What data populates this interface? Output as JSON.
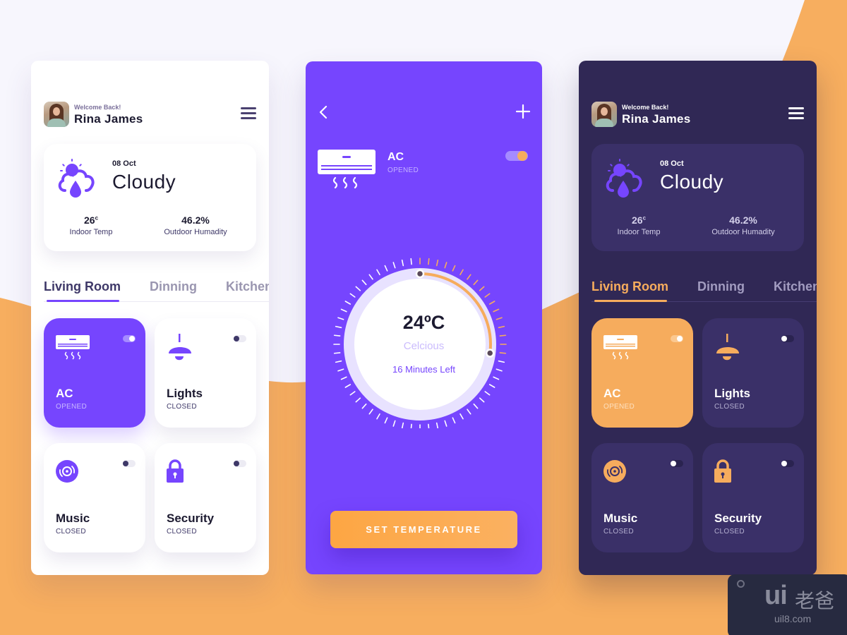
{
  "colors": {
    "primary": "#7645fe",
    "accent": "#f6ac5d",
    "dark_bg": "#302855",
    "dark_card": "#3a3068",
    "light_bg": "#f7f6fd"
  },
  "screens": {
    "light": {
      "header": {
        "welcome": "Welcome Back!",
        "name": "Rina James",
        "menu_icon": "hamburger-menu-icon"
      },
      "weather": {
        "icon": "cloud-rain-sun-icon",
        "date": "08 Oct",
        "condition": "Cloudy",
        "indoor_temp_value": "26",
        "indoor_temp_unit": "c",
        "indoor_temp_label": "Indoor Temp",
        "humidity_value": "46.2%",
        "humidity_label": "Outdoor Humadity"
      },
      "tabs": [
        {
          "label": "Living Room",
          "active": true
        },
        {
          "label": "Dinning",
          "active": false
        },
        {
          "label": "Kitchen",
          "active": false
        }
      ],
      "devices": [
        {
          "name": "AC",
          "state": "OPENED",
          "on": true,
          "icon": "air-conditioner-icon"
        },
        {
          "name": "Lights",
          "state": "CLOSED",
          "on": false,
          "icon": "ceiling-lamp-icon"
        },
        {
          "name": "Music",
          "state": "CLOSED",
          "on": false,
          "icon": "vinyl-disc-icon"
        },
        {
          "name": "Security",
          "state": "CLOSED",
          "on": false,
          "icon": "padlock-icon"
        }
      ]
    },
    "ac_detail": {
      "back_icon": "chevron-left-icon",
      "add_icon": "plus-icon",
      "device_name": "AC",
      "device_state": "OPENED",
      "device_on": true,
      "temperature": "24ºC",
      "unit_label": "Celcious",
      "time_left": "16 Minutes Left",
      "dial_progress": 0.27,
      "set_button": "SET TEMPERATURE"
    },
    "dark": {
      "header": {
        "welcome": "Welcome Back!",
        "name": "Rina James",
        "menu_icon": "hamburger-menu-icon"
      },
      "weather": {
        "icon": "cloud-rain-sun-icon",
        "date": "08 Oct",
        "condition": "Cloudy",
        "indoor_temp_value": "26",
        "indoor_temp_unit": "c",
        "indoor_temp_label": "Indoor Temp",
        "humidity_value": "46.2%",
        "humidity_label": "Outdoor Humadity"
      },
      "tabs": [
        {
          "label": "Living Room",
          "active": true
        },
        {
          "label": "Dinning",
          "active": false
        },
        {
          "label": "Kitchen",
          "active": false
        }
      ],
      "devices": [
        {
          "name": "AC",
          "state": "OPENED",
          "on": true,
          "icon": "air-conditioner-icon"
        },
        {
          "name": "Lights",
          "state": "CLOSED",
          "on": false,
          "icon": "ceiling-lamp-icon"
        },
        {
          "name": "Music",
          "state": "CLOSED",
          "on": false,
          "icon": "vinyl-disc-icon"
        },
        {
          "name": "Security",
          "state": "CLOSED",
          "on": false,
          "icon": "padlock-icon"
        }
      ]
    }
  },
  "watermark": {
    "logo": "ui",
    "logo_cn": "老爸",
    "url": "uil8.com"
  }
}
